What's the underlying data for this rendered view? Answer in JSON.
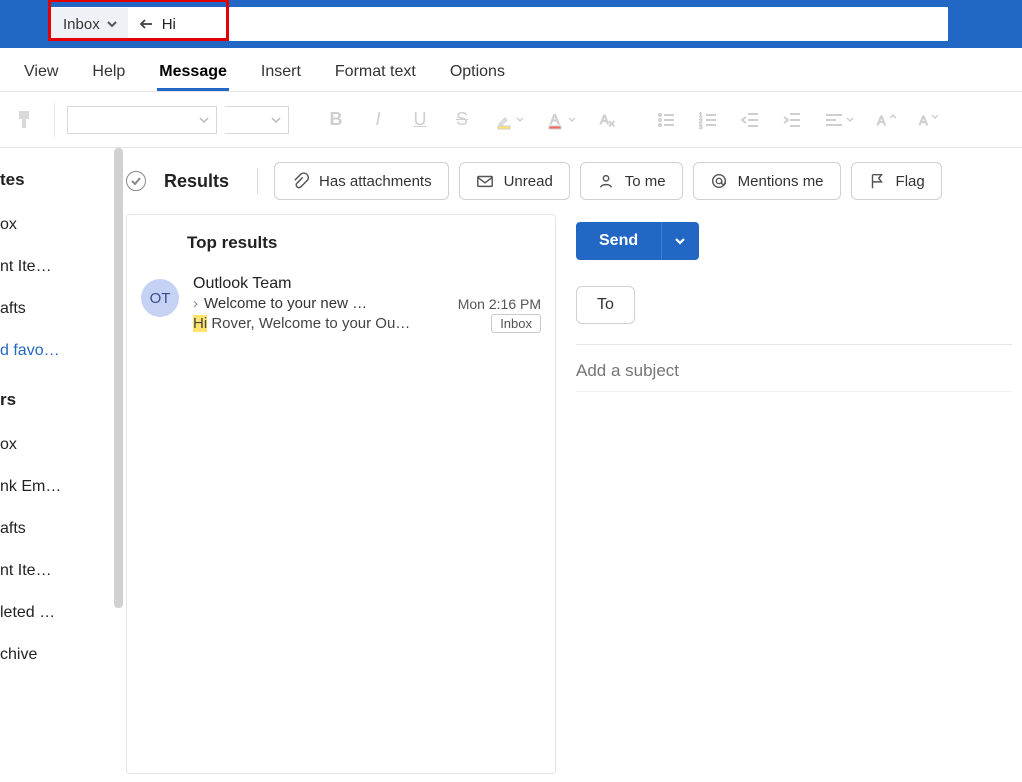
{
  "search": {
    "scope": "Inbox",
    "query": "Hi"
  },
  "ribbon": {
    "tabs": [
      "View",
      "Help",
      "Message",
      "Insert",
      "Format text",
      "Options"
    ],
    "active": "Message"
  },
  "sidebar": {
    "favorites_heading": "tes",
    "favorites": [
      "ox",
      "nt Ite…",
      "afts"
    ],
    "add_favorite": "d favo…",
    "folders_heading": "rs",
    "folders": [
      "ox",
      "nk Em…",
      "afts",
      "nt Ite…",
      "leted …",
      "chive"
    ]
  },
  "filters": {
    "results_label": "Results",
    "chips": {
      "attachments": "Has attachments",
      "unread": "Unread",
      "tome": "To me",
      "mentions": "Mentions me",
      "flag": "Flag"
    }
  },
  "results": {
    "header": "Top results",
    "items": [
      {
        "avatar": "OT",
        "from": "Outlook Team",
        "subject": "Welcome to your new …",
        "time": "Mon 2:16 PM",
        "preview_hl": "Hi",
        "preview_rest": " Rover, Welcome to your Ou…",
        "folder": "Inbox"
      }
    ]
  },
  "compose": {
    "send": "Send",
    "to": "To",
    "subject_placeholder": "Add a subject"
  }
}
